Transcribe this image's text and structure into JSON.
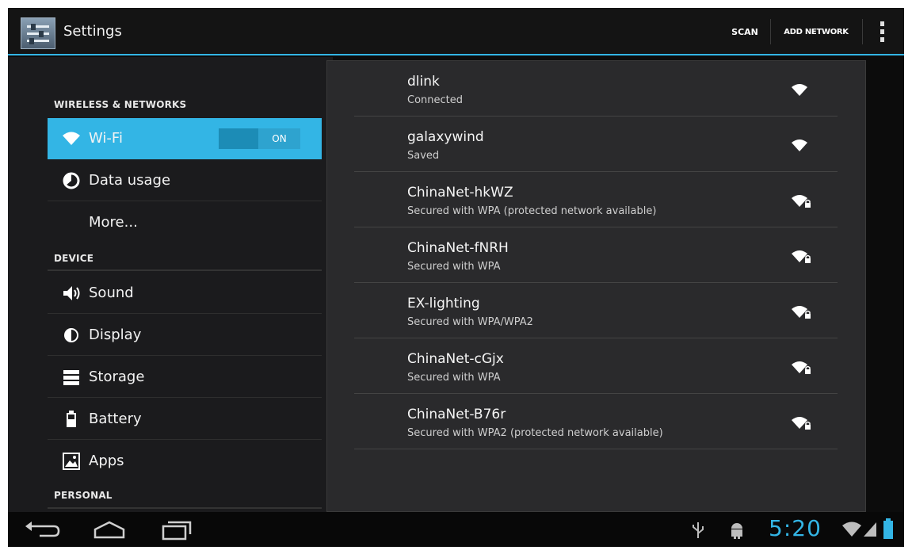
{
  "actionbar": {
    "title": "Settings",
    "scan_label": "SCAN",
    "add_network_label": "ADD NETWORK",
    "accent_color": "#33b5e5"
  },
  "settings_menu": {
    "sections": [
      {
        "header": "WIRELESS & NETWORKS"
      },
      {
        "header": "DEVICE"
      },
      {
        "header": "PERSONAL"
      }
    ],
    "items": [
      {
        "label": "Wi-Fi",
        "icon": "wifi-icon",
        "selected": true,
        "toggle": "ON"
      },
      {
        "label": "Data usage",
        "icon": "data-usage-icon"
      },
      {
        "label": "More...",
        "icon": ""
      },
      {
        "label": "Sound",
        "icon": "speaker-icon"
      },
      {
        "label": "Display",
        "icon": "display-icon"
      },
      {
        "label": "Storage",
        "icon": "storage-icon"
      },
      {
        "label": "Battery",
        "icon": "battery-icon"
      },
      {
        "label": "Apps",
        "icon": "apps-icon"
      }
    ]
  },
  "networks": [
    {
      "ssid": "dlink",
      "status": "Connected",
      "secured": false,
      "signal_icon": "wifi-signal-icon"
    },
    {
      "ssid": "galaxywind",
      "status": "Saved",
      "secured": false,
      "signal_icon": "wifi-signal-icon"
    },
    {
      "ssid": "ChinaNet-hkWZ",
      "status": "Secured with WPA (protected network available)",
      "secured": true,
      "signal_icon": "wifi-locked-icon"
    },
    {
      "ssid": "ChinaNet-fNRH",
      "status": "Secured with WPA",
      "secured": true,
      "signal_icon": "wifi-locked-icon"
    },
    {
      "ssid": "EX-lighting",
      "status": "Secured with WPA/WPA2",
      "secured": true,
      "signal_icon": "wifi-locked-icon"
    },
    {
      "ssid": "ChinaNet-cGjx",
      "status": "Secured with WPA",
      "secured": true,
      "signal_icon": "wifi-locked-icon"
    },
    {
      "ssid": "ChinaNet-B76r",
      "status": "Secured with WPA2 (protected network available)",
      "secured": true,
      "signal_icon": "wifi-locked-icon"
    }
  ],
  "navbar": {
    "buttons": [
      "back-icon",
      "home-icon",
      "recent-apps-icon"
    ],
    "status_icons": [
      "usb-icon",
      "android-debug-icon",
      "wifi-status-icon",
      "cell-signal-icon",
      "battery-status-icon"
    ],
    "time": "5:20"
  }
}
